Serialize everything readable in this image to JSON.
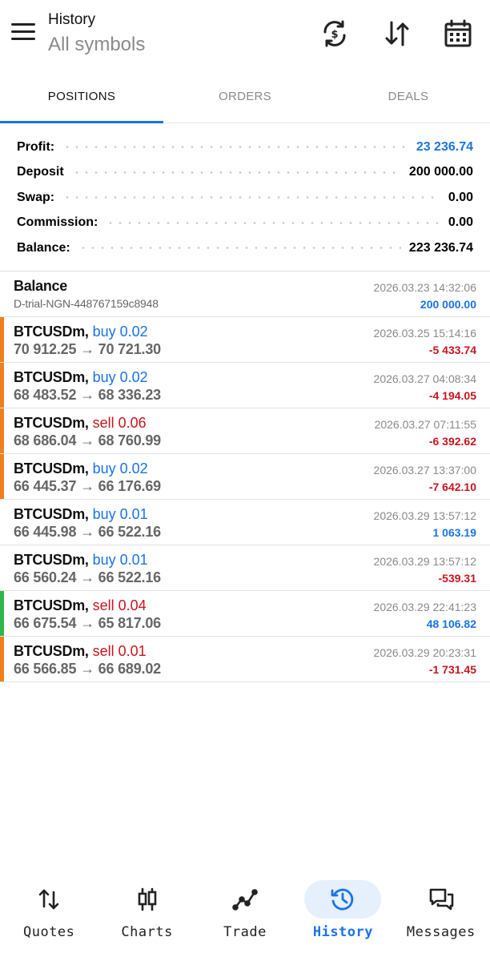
{
  "header": {
    "title": "History",
    "subtitle": "All symbols",
    "icons": [
      "sync-currency-icon",
      "sort-icon",
      "calendar-icon"
    ]
  },
  "tabs": [
    {
      "label": "POSITIONS",
      "active": true
    },
    {
      "label": "ORDERS",
      "active": false
    },
    {
      "label": "DEALS",
      "active": false
    }
  ],
  "summary": {
    "profit_label": "Profit:",
    "profit_value": "23 236.74",
    "deposit_label": "Deposit",
    "deposit_value": "200 000.00",
    "swap_label": "Swap:",
    "swap_value": "0.00",
    "commission_label": "Commission:",
    "commission_value": "0.00",
    "balance_label": "Balance:",
    "balance_value": "223 236.74"
  },
  "balance_entry": {
    "title": "Balance",
    "account": "D-trial-NGN-448767159c8948",
    "time": "2026.03.23 14:32:06",
    "amount": "200 000.00"
  },
  "positions": [
    {
      "symbol": "BTCUSDm,",
      "side": "buy 0.02",
      "side_color": "#1a73e8",
      "prices": "70 912.25 → 70 721.30",
      "time": "2026.03.25 15:14:16",
      "pnl": "-5 433.74",
      "pnl_color": "#c8141e",
      "bar_color": "#f07f1e"
    },
    {
      "symbol": "BTCUSDm,",
      "side": "buy 0.02",
      "side_color": "#1a73e8",
      "prices": "68 483.52 → 68 336.23",
      "time": "2026.03.27 04:08:34",
      "pnl": "-4 194.05",
      "pnl_color": "#c8141e",
      "bar_color": "#f07f1e"
    },
    {
      "symbol": "BTCUSDm,",
      "side": "sell 0.06",
      "side_color": "#c8141e",
      "prices": "68 686.04 → 68 760.99",
      "time": "2026.03.27 07:11:55",
      "pnl": "-6 392.62",
      "pnl_color": "#c8141e",
      "bar_color": "#f07f1e"
    },
    {
      "symbol": "BTCUSDm,",
      "side": "buy 0.02",
      "side_color": "#1a73e8",
      "prices": "66 445.37 → 66 176.69",
      "time": "2026.03.27 13:37:00",
      "pnl": "-7 642.10",
      "pnl_color": "#c8141e",
      "bar_color": "#f07f1e"
    },
    {
      "symbol": "BTCUSDm,",
      "side": "buy 0.01",
      "side_color": "#1a73e8",
      "prices": "66 445.98 → 66 522.16",
      "time": "2026.03.29 13:57:12",
      "pnl": "1 063.19",
      "pnl_color": "#1a73e8",
      "bar_color": ""
    },
    {
      "symbol": "BTCUSDm,",
      "side": "buy 0.01",
      "side_color": "#1a73e8",
      "prices": "66 560.24 → 66 522.16",
      "time": "2026.03.29 13:57:12",
      "pnl": "-539.31",
      "pnl_color": "#c8141e",
      "bar_color": ""
    },
    {
      "symbol": "BTCUSDm,",
      "side": "sell 0.04",
      "side_color": "#c8141e",
      "prices": "66 675.54 → 65 817.06",
      "time": "2026.03.29 22:41:23",
      "pnl": "48 106.82",
      "pnl_color": "#1a73e8",
      "bar_color": "#2eb84b"
    },
    {
      "symbol": "BTCUSDm,",
      "side": "sell 0.01",
      "side_color": "#c8141e",
      "prices": "66 566.85 → 66 689.02",
      "time": "2026.03.29 20:23:31",
      "pnl": "-1 731.45",
      "pnl_color": "#c8141e",
      "bar_color": "#f07f1e"
    }
  ],
  "bottom_nav": [
    {
      "label": "Quotes",
      "icon": "quotes-arrows-icon",
      "active": false
    },
    {
      "label": "Charts",
      "icon": "candlestick-icon",
      "active": false
    },
    {
      "label": "Trade",
      "icon": "trade-line-icon",
      "active": false
    },
    {
      "label": "History",
      "icon": "history-clock-icon",
      "active": true
    },
    {
      "label": "Messages",
      "icon": "messages-icon",
      "active": false
    }
  ],
  "colors": {
    "accent": "#1a73e8",
    "loss": "#c8141e",
    "open_bar": "#f07f1e",
    "win_bar": "#2eb84b"
  }
}
